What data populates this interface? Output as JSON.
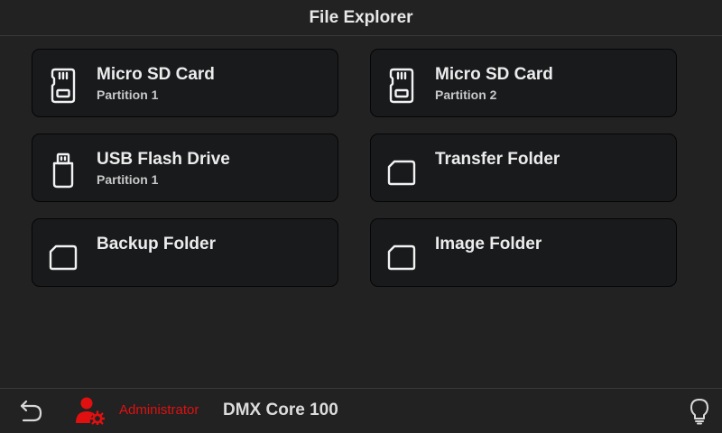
{
  "header": {
    "title": "File Explorer"
  },
  "cards": [
    {
      "icon": "sd-card-icon",
      "title": "Micro SD Card",
      "subtitle": "Partition 1"
    },
    {
      "icon": "sd-card-icon",
      "title": "Micro SD Card",
      "subtitle": "Partition 2"
    },
    {
      "icon": "usb-drive-icon",
      "title": "USB Flash Drive",
      "subtitle": "Partition 1"
    },
    {
      "icon": "folder-icon",
      "title": "Transfer Folder",
      "subtitle": ""
    },
    {
      "icon": "folder-icon",
      "title": "Backup Folder",
      "subtitle": ""
    },
    {
      "icon": "folder-icon",
      "title": "Image Folder",
      "subtitle": ""
    }
  ],
  "footer": {
    "back_icon": "back-arrow-icon",
    "user_icon": "admin-user-gear-icon",
    "user_role": "Administrator",
    "device_name": "DMX Core 100",
    "help_icon": "lightbulb-icon"
  },
  "colors": {
    "background": "#222222",
    "card_background": "#181a1c",
    "accent_red": "#e01010",
    "text": "#ececec"
  }
}
